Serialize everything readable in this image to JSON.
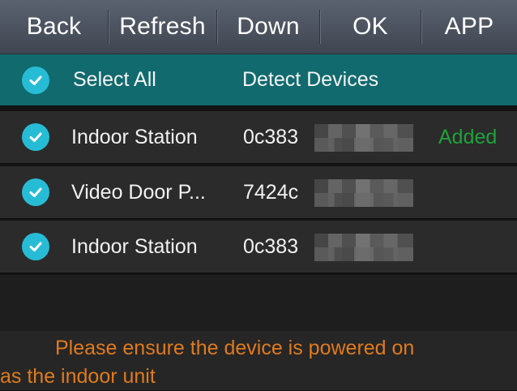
{
  "toolbar": {
    "back": "Back",
    "refresh": "Refresh",
    "down": "Down",
    "ok": "OK",
    "app": "APP"
  },
  "header": {
    "select_all": "Select All",
    "column": "Detect Devices"
  },
  "devices": [
    {
      "name": "Indoor Station",
      "serial": "0c383",
      "status": "Added",
      "checked": true
    },
    {
      "name": "Video Door P...",
      "serial": "7424c",
      "status": "",
      "checked": true
    },
    {
      "name": "Indoor Station",
      "serial": "0c383",
      "status": "",
      "checked": true
    }
  ],
  "notice": {
    "line1": "Please ensure the device is powered on",
    "line2": "as the indoor unit"
  },
  "colors": {
    "header_bg": "#116a6e",
    "check": "#27bcd6",
    "added": "#1fa13a",
    "notice_text": "#e07a1e"
  }
}
